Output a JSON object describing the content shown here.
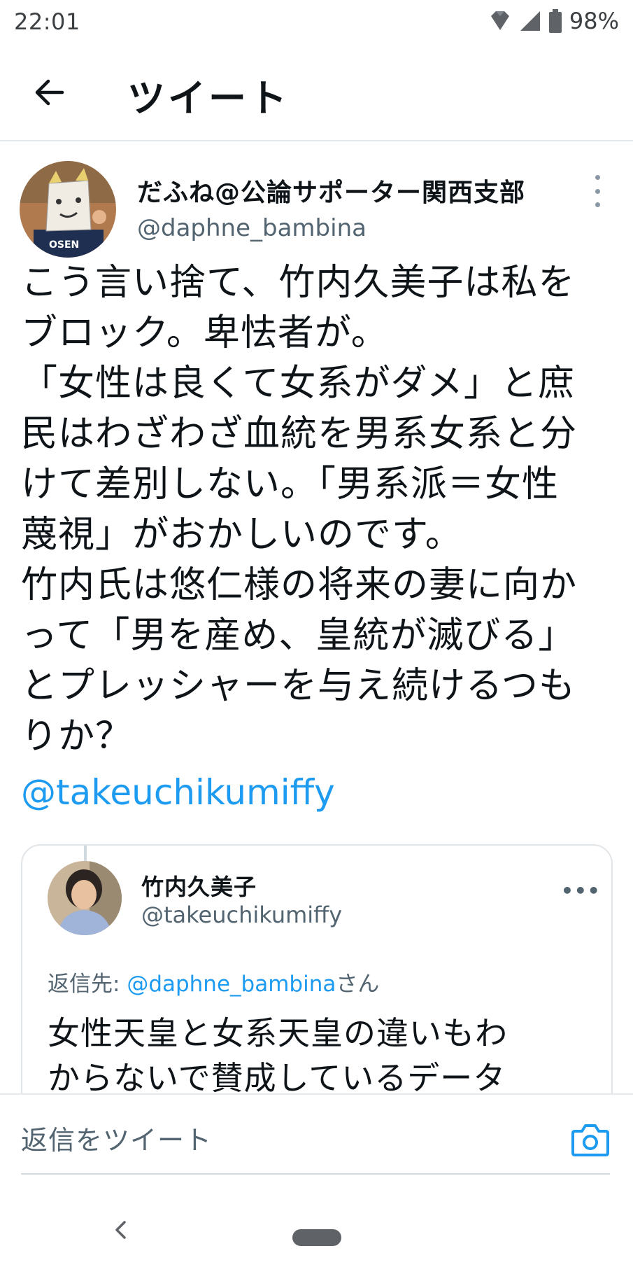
{
  "status_bar": {
    "time": "22:01",
    "battery_percent": "98%",
    "icons": [
      "data-saver-icon",
      "signal-icon",
      "battery-icon"
    ]
  },
  "header": {
    "back_icon": "arrow-left-icon",
    "title": "ツイート"
  },
  "tweet": {
    "author_name": "だふね@公論サポーター関西支部",
    "author_handle": "@daphne_bambina",
    "more_icon": "more-vertical-icon",
    "text_lines": [
      "こう言い捨て、竹内久美子は私を",
      "ブロック。卑怯者が。",
      "「女性は良くて女系がダメ」と庶",
      "民はわざわざ血統を男系女系と分",
      "けて差別しない。「男系派＝女性",
      "蔑視」がおかしいのです。",
      "竹内氏は悠仁様の将来の妻に向か",
      "って「男を産め、皇統が滅びる」",
      "とプレッシャーを与え続けるつも",
      "りか？"
    ],
    "mention": "@takeuchikumiffy"
  },
  "quoted_tweet": {
    "author_name": "竹内久美子",
    "author_handle": "@takeuchikumiffy",
    "more_label": "•••",
    "reply_prefix": "返信先: ",
    "reply_handle": "@daphne_bambina",
    "reply_suffix": "さん",
    "text_lines": [
      "女性天皇と女系天皇の違いもわ",
      "からないで賛成しているデータ"
    ]
  },
  "reply_bar": {
    "placeholder": "返信をツイート",
    "camera_icon": "camera-icon"
  },
  "nav_bar": {
    "back_icon": "nav-back-icon",
    "home_icon": "nav-home-pill"
  },
  "colors": {
    "accent": "#1d9bf0",
    "secondary_text": "#536471",
    "divider": "#e6e9ec"
  }
}
